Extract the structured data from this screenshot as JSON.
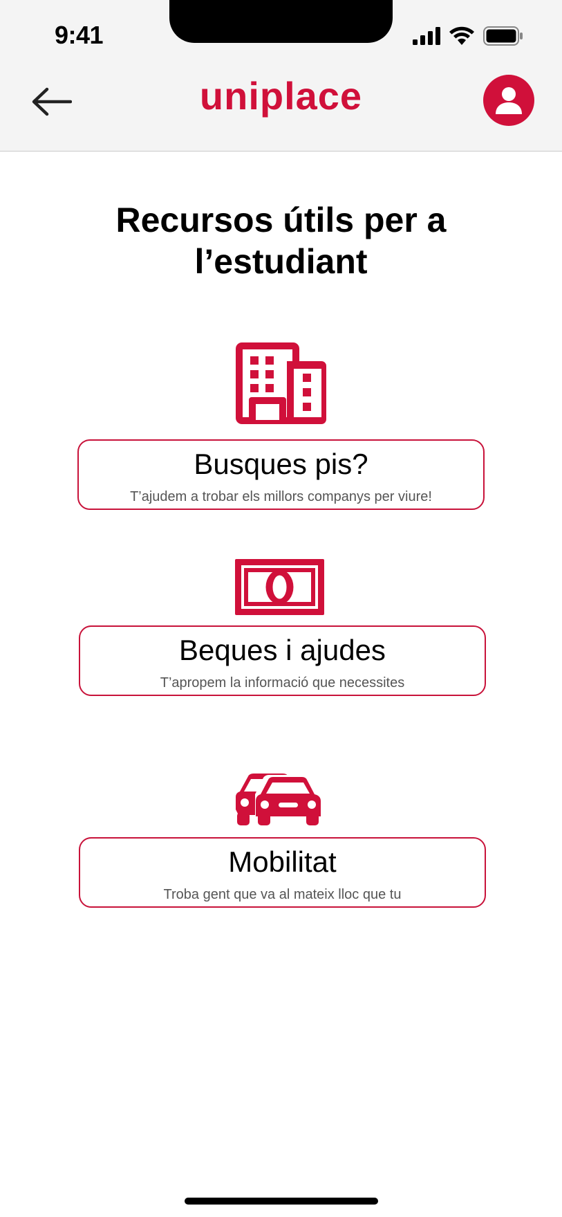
{
  "status_bar": {
    "time": "9:41"
  },
  "header": {
    "brand": "uniplace"
  },
  "page": {
    "title_line1": "Recursos útils per a",
    "title_line2": "l’estudiant"
  },
  "resources": [
    {
      "icon": "building-icon",
      "title": "Busques pis?",
      "subtitle": "T’ajudem a trobar els millors companys per viure!"
    },
    {
      "icon": "banknote-icon",
      "title": "Beques i ajudes",
      "subtitle": "T’apropem la informació que necessites"
    },
    {
      "icon": "cars-icon",
      "title": "Mobilitat",
      "subtitle": "Troba gent que va al mateix lloc que tu"
    }
  ],
  "colors": {
    "accent": "#d0103a",
    "header_bg": "#f4f4f4",
    "card_border": "#c8123a"
  }
}
